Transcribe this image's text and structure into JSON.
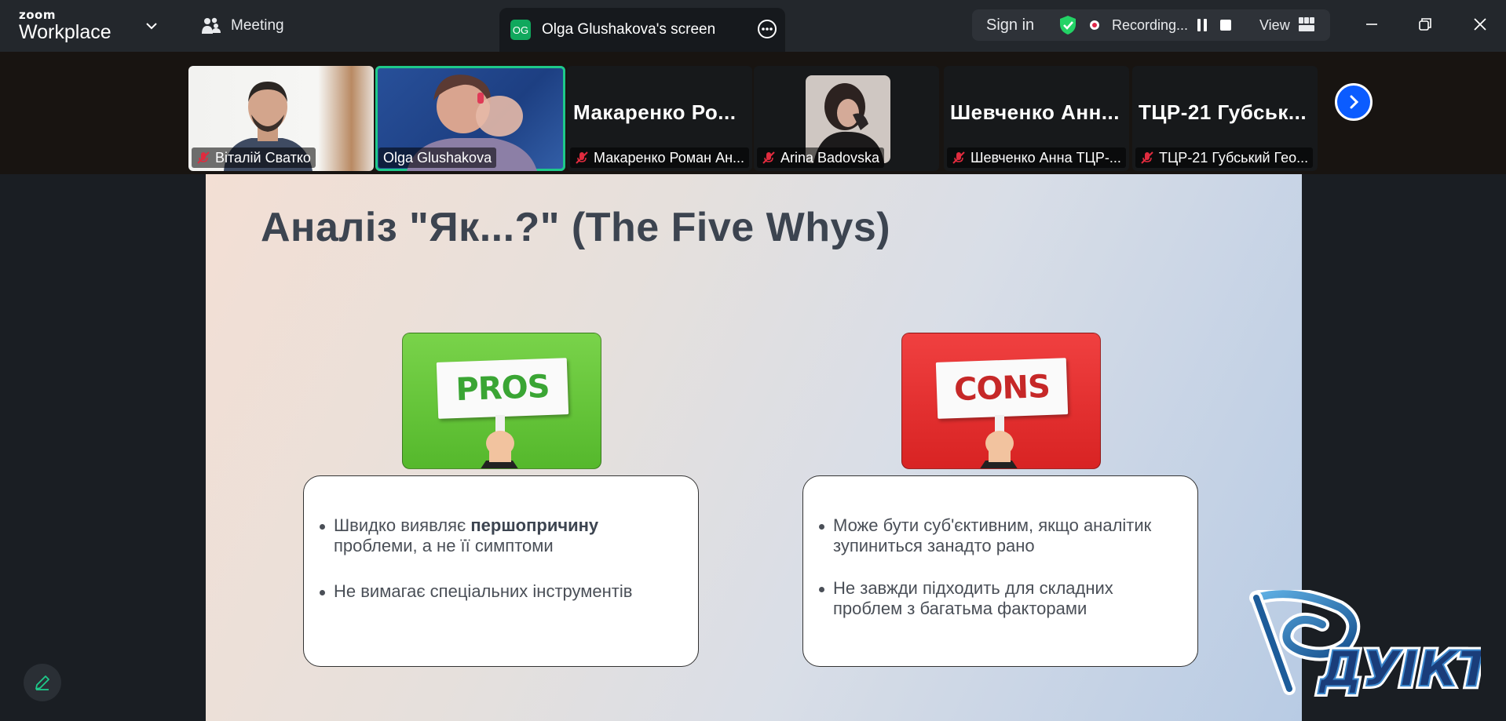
{
  "app": {
    "brand_small": "zoom",
    "brand_big": "Workplace",
    "meeting_label": "Meeting",
    "screen_tab": {
      "badge": "OG",
      "label": "Olga Glushakova's screen"
    },
    "sign_in": "Sign in",
    "recording": "Recording...",
    "view": "View"
  },
  "participants": [
    {
      "name": "Віталій Сватко",
      "muted": true,
      "type": "video"
    },
    {
      "name": "Olga Glushakova",
      "muted": false,
      "type": "video",
      "active": true
    },
    {
      "display": "Макаренко  Ро...",
      "name": "Макаренко Роман Ан...",
      "muted": true,
      "type": "name"
    },
    {
      "name": "Arina Badovska",
      "muted": true,
      "type": "photo"
    },
    {
      "display": "Шевченко  Анн...",
      "name": "Шевченко Анна ТЦР-...",
      "muted": true,
      "type": "name"
    },
    {
      "display": "ТЦР-21  Губськ...",
      "name": "ТЦР-21 Губський Гео...",
      "muted": true,
      "type": "name"
    }
  ],
  "slide": {
    "title": "Аналіз \"Як...?\" (The Five Whys)",
    "pros": {
      "sign": "PROS",
      "bullets": [
        {
          "pre": "Швидко виявляє ",
          "bold": "першопричину",
          "post": " проблеми, а не її симптоми"
        },
        {
          "pre": "Не вимагає спеціальних інструментів",
          "bold": "",
          "post": ""
        }
      ]
    },
    "cons": {
      "sign": "CONS",
      "bullets": [
        {
          "pre": "Може бути суб'єктивним, якщо аналітик зупиниться занадто рано",
          "bold": "",
          "post": ""
        },
        {
          "pre": "Не завжди підходить для складних проблем з багатьма факторами",
          "bold": "",
          "post": ""
        }
      ]
    },
    "logo_text": "ДУІКТ"
  },
  "colors": {
    "accent_green": "#1ec98a",
    "pros_green": "#5cc236",
    "cons_red": "#e53030",
    "zoom_blue": "#0b5cff",
    "recording_red": "#e0294a"
  }
}
